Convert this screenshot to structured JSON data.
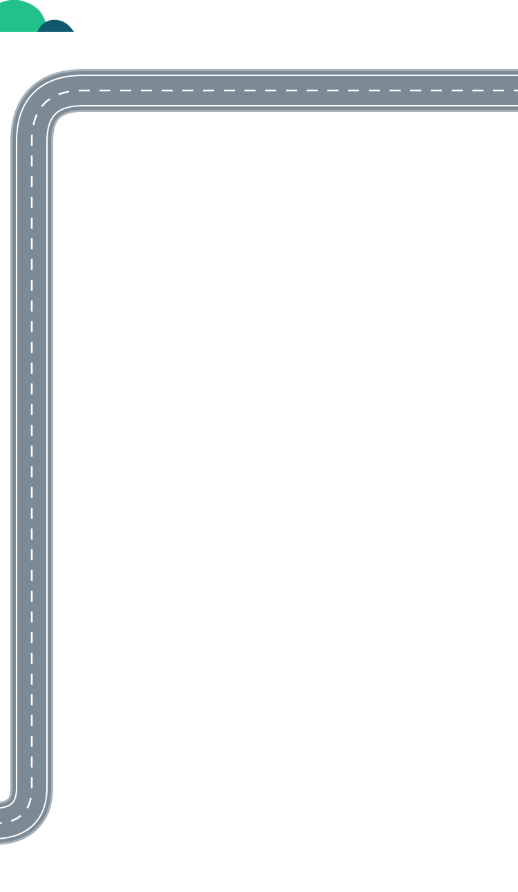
{
  "scene": {
    "background_color": "#ffffff",
    "decor": {
      "hill_green_color": "#22c08a",
      "hill_teal_color": "#0f5a6e"
    },
    "road": {
      "asphalt_color": "#7c8a95",
      "edge_color": "#ffffff",
      "outer_border_color": "#a7b1b9",
      "center_dash_color": "#ffffff"
    }
  }
}
